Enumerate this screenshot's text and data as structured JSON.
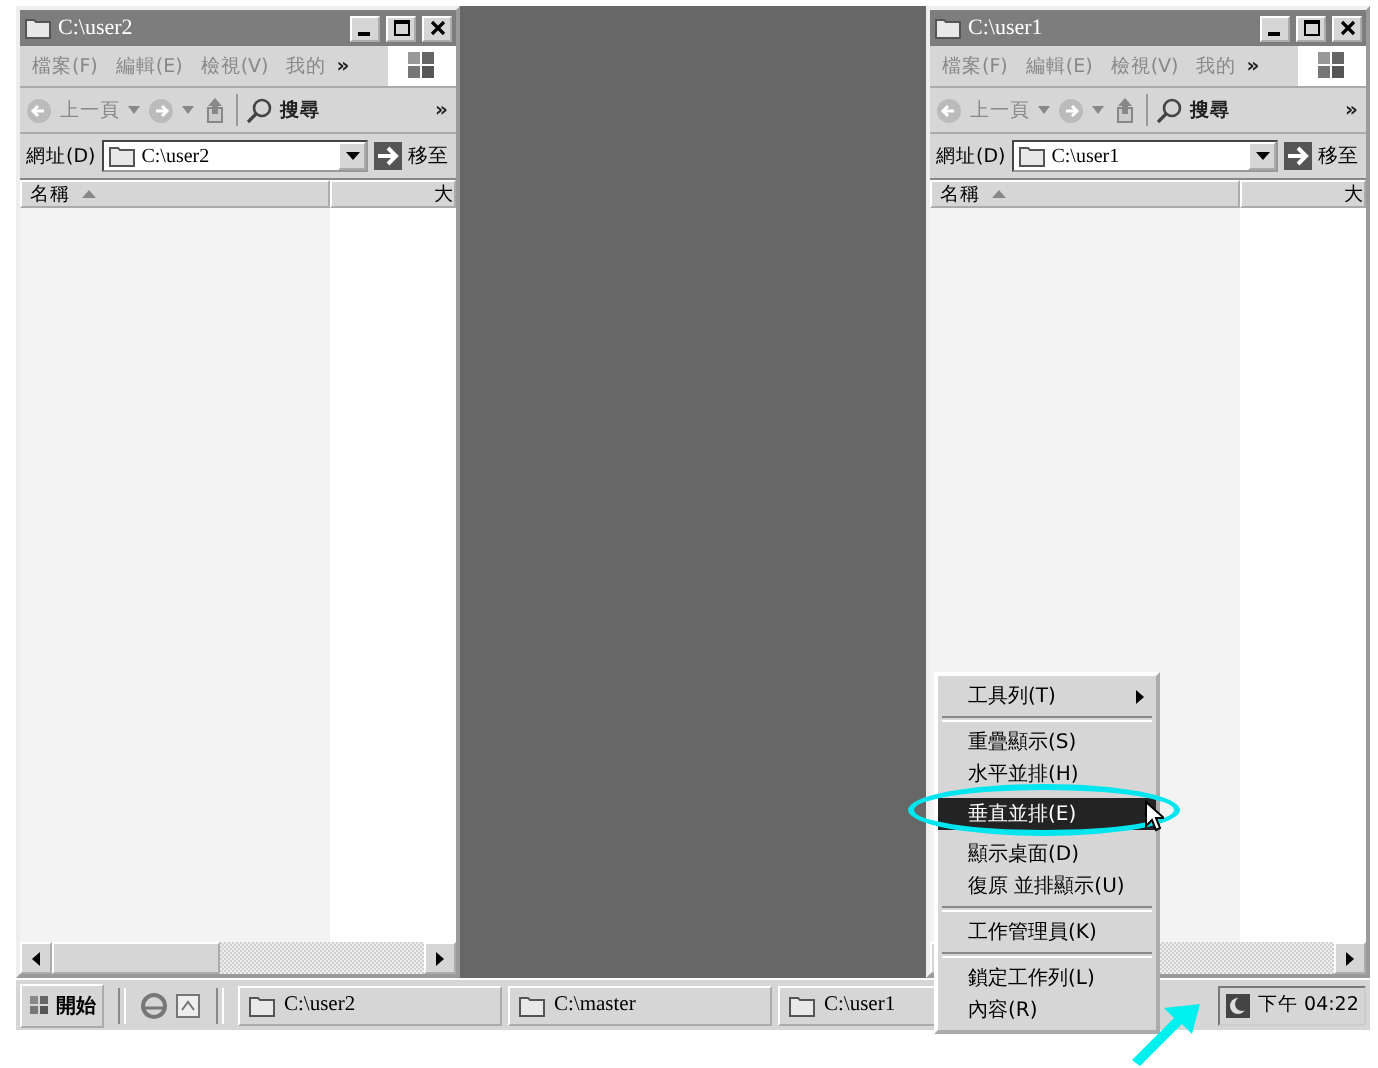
{
  "windows": [
    {
      "title": "C:\\user2",
      "menu": [
        "檔案(F)",
        "編輯(E)",
        "檢視(V)",
        "我的"
      ],
      "more": "»",
      "toolbar": {
        "back": "上一頁",
        "search": "搜尋",
        "more": "»"
      },
      "address": {
        "label": "網址(D)",
        "value": "C:\\user2",
        "go": "移至"
      },
      "columns": [
        "名稱",
        "大"
      ]
    },
    {
      "title": "C:\\user1",
      "menu": [
        "檔案(F)",
        "編輯(E)",
        "檢視(V)",
        "我的"
      ],
      "more": "»",
      "toolbar": {
        "back": "上一頁",
        "search": "搜尋",
        "more": "»"
      },
      "address": {
        "label": "網址(D)",
        "value": "C:\\user1",
        "go": "移至"
      },
      "columns": [
        "名稱",
        "大"
      ]
    }
  ],
  "taskbar": {
    "start": "開始",
    "tasks": [
      {
        "label": "C:\\user2"
      },
      {
        "label": "C:\\master"
      },
      {
        "label": "C:\\user1"
      }
    ],
    "clock": "下午 04:22"
  },
  "context_menu": {
    "items": [
      {
        "kind": "item",
        "label": "工具列(T)",
        "submenu": true,
        "selected": false
      },
      {
        "kind": "separator"
      },
      {
        "kind": "item",
        "label": "重疊顯示(S)",
        "submenu": false,
        "selected": false
      },
      {
        "kind": "item",
        "label": "水平並排(H)",
        "submenu": false,
        "selected": false
      },
      {
        "kind": "item",
        "label": "垂直並排(E)",
        "submenu": false,
        "selected": true
      },
      {
        "kind": "item",
        "label": "顯示桌面(D)",
        "submenu": false,
        "selected": false
      },
      {
        "kind": "item",
        "label": "復原 並排顯示(U)",
        "submenu": false,
        "selected": false
      },
      {
        "kind": "separator"
      },
      {
        "kind": "item",
        "label": "工作管理員(K)",
        "submenu": false,
        "selected": false
      },
      {
        "kind": "separator"
      },
      {
        "kind": "item",
        "label": "鎖定工作列(L)",
        "submenu": false,
        "selected": false
      },
      {
        "kind": "item",
        "label": "內容(R)",
        "submenu": false,
        "selected": false
      }
    ]
  }
}
